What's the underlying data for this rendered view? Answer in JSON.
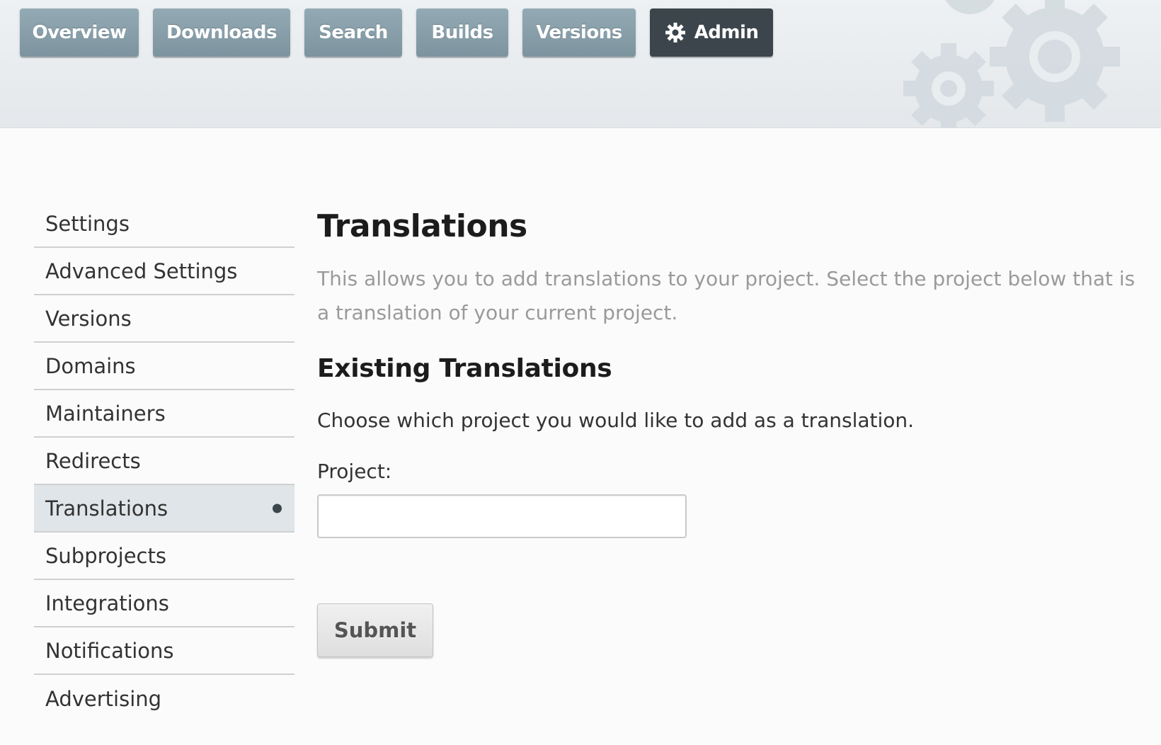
{
  "nav": {
    "tabs": [
      {
        "label": "Overview"
      },
      {
        "label": "Downloads"
      },
      {
        "label": "Search"
      },
      {
        "label": "Builds"
      },
      {
        "label": "Versions"
      },
      {
        "label": "Admin",
        "icon": "gear-icon",
        "active": true
      }
    ]
  },
  "sidebar": {
    "items": [
      {
        "label": "Settings"
      },
      {
        "label": "Advanced Settings"
      },
      {
        "label": "Versions"
      },
      {
        "label": "Domains"
      },
      {
        "label": "Maintainers"
      },
      {
        "label": "Redirects"
      },
      {
        "label": "Translations",
        "active": true
      },
      {
        "label": "Subprojects"
      },
      {
        "label": "Integrations"
      },
      {
        "label": "Notifications"
      },
      {
        "label": "Advertising"
      }
    ]
  },
  "main": {
    "title": "Translations",
    "intro": "This allows you to add translations to your project. Select the project below that is a translation of your current project.",
    "section_title": "Existing Translations",
    "instructions": "Choose which project you would like to add as a translation.",
    "project_label": "Project:",
    "project_value": "",
    "submit_label": "Submit"
  },
  "colors": {
    "tab": "#8ba2ad",
    "tab_active": "#3b454b",
    "sidebar_active": "#dfe5e8",
    "intro_text": "#9a9a9a"
  }
}
